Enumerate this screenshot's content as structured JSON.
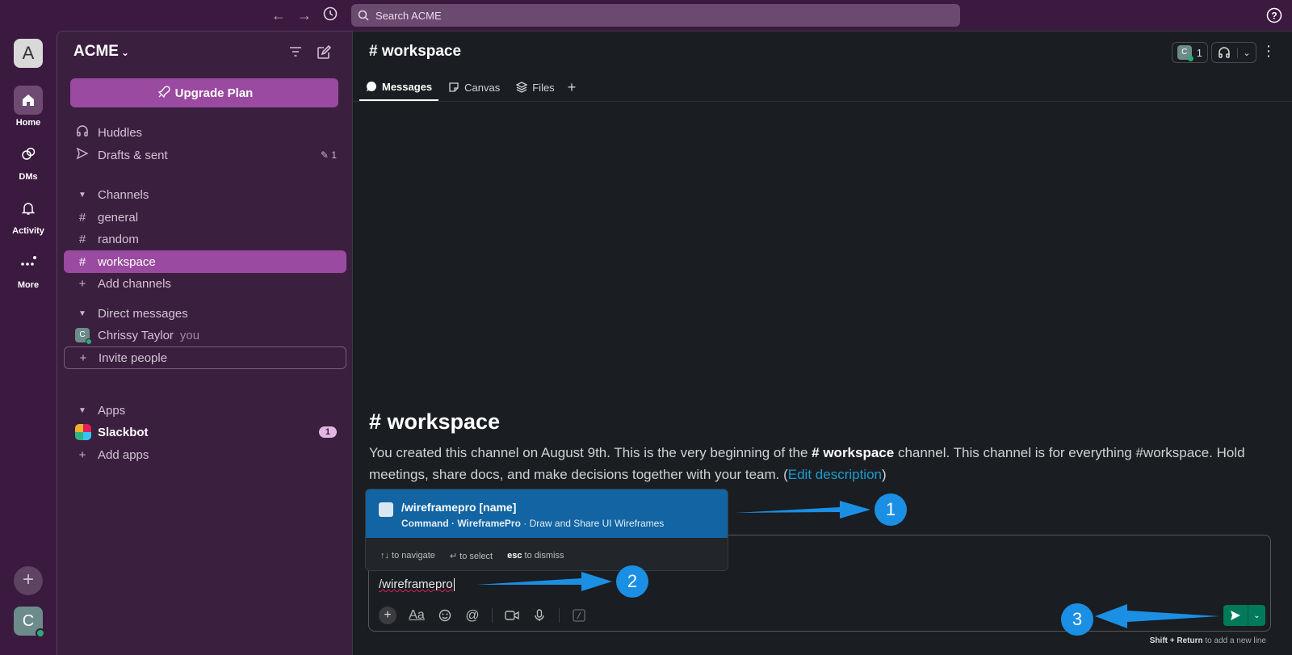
{
  "topbar": {
    "search_placeholder": "Search ACME"
  },
  "rail": {
    "workspace_initial": "A",
    "items": [
      {
        "label": "Home"
      },
      {
        "label": "DMs"
      },
      {
        "label": "Activity"
      },
      {
        "label": "More"
      }
    ],
    "user_initial": "C"
  },
  "sidebar": {
    "workspace_name": "ACME",
    "upgrade_label": "Upgrade Plan",
    "huddles": "Huddles",
    "drafts": "Drafts & sent",
    "drafts_count": "1",
    "channels_header": "Channels",
    "channels": [
      {
        "name": "general"
      },
      {
        "name": "random"
      },
      {
        "name": "workspace"
      }
    ],
    "add_channels": "Add channels",
    "dm_header": "Direct messages",
    "dm_user": "Chrissy Taylor",
    "dm_user_initial": "C",
    "dm_you": "you",
    "invite": "Invite people",
    "apps_header": "Apps",
    "slackbot": "Slackbot",
    "slackbot_badge": "1",
    "add_apps": "Add apps"
  },
  "main": {
    "channel_title": "# workspace",
    "member_initial": "C",
    "member_count": "1",
    "tabs": [
      {
        "label": "Messages"
      },
      {
        "label": "Canvas"
      },
      {
        "label": "Files"
      }
    ],
    "intro_title": "# workspace",
    "intro_p1": "You created this channel on August 9th. This is the very beginning of the ",
    "intro_channel": "# workspace",
    "intro_p2": " channel. This channel is for everything #workspace. Hold meetings, share docs, and make decisions together with your team. (",
    "intro_link": "Edit description",
    "intro_p3": ")"
  },
  "popup": {
    "command": "/wireframepro [name]",
    "sub_bold": "Command · WireframePro",
    "sub_rest": " · Draw and Share UI Wireframes",
    "nav_hint": "↑↓ to navigate",
    "select_hint": "↵ to select",
    "esc_key": "esc",
    "esc_hint": " to dismiss"
  },
  "composer": {
    "value": "/wireframepro",
    "hint_bold": "Shift + Return",
    "hint_rest": " to add a new line"
  },
  "callouts": [
    "1",
    "2",
    "3"
  ],
  "colors": {
    "accent": "#9a4aa0",
    "send": "#007a5a",
    "selection": "#1264a3",
    "callout": "#1a8fe3"
  }
}
